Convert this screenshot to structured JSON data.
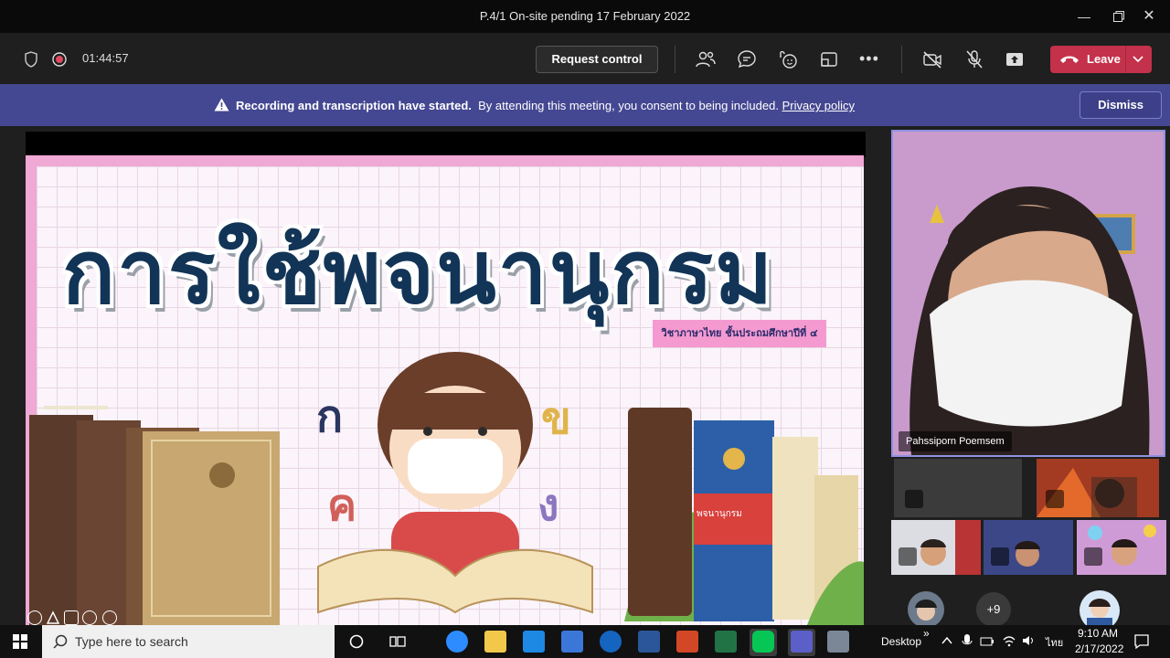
{
  "window": {
    "title": "P.4/1 On-site pending 17 February 2022"
  },
  "toolbar": {
    "timer": "01:44:57",
    "request_control_label": "Request control",
    "leave_label": "Leave"
  },
  "banner": {
    "bold_text": "Recording and transcription have started.",
    "text": "By attending this meeting, you consent to being included.",
    "link_text": "Privacy policy",
    "dismiss_label": "Dismiss"
  },
  "slide": {
    "title": "การใช้พจนานุกรม",
    "subject": "วิชาภาษาไทย ชั้นประถมศึกษาปีที่ ๔",
    "book_label": "พจนานุกรม"
  },
  "participants": {
    "presenter_name": "Pahssiporn Poemsem",
    "more_count": "+9"
  },
  "taskbar": {
    "search_placeholder": "Type here to search",
    "desktop_label": "Desktop",
    "language": "ไทย",
    "time": "9:10 AM",
    "date": "2/17/2022"
  },
  "colors": {
    "banner": "#444791",
    "leave": "#c4314b",
    "title_text": "#123456"
  }
}
